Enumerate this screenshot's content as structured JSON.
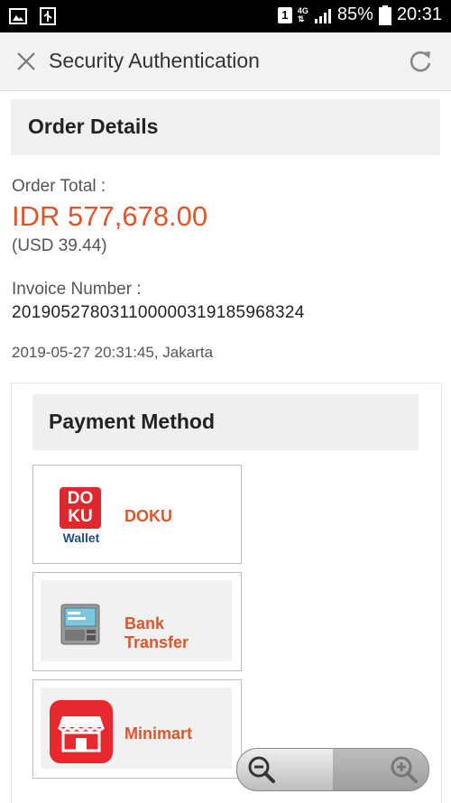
{
  "status_bar": {
    "sim_badge": "1",
    "network": "4G",
    "battery": "85%",
    "time": "20:31",
    "icons": [
      "image-icon",
      "usb-icon",
      "signal-icon",
      "battery-icon"
    ]
  },
  "header": {
    "title": "Security Authentication",
    "icons": [
      "close-icon",
      "refresh-icon"
    ]
  },
  "order": {
    "section_title": "Order Details",
    "total_label": "Order Total :",
    "total_value": "IDR 577,678.00",
    "total_usd": "(USD 39.44)",
    "invoice_label": "Invoice Number :",
    "invoice_number": "20190527803110000031918596832​4",
    "datetime": "2019-05-27 20:31:45, Jakarta"
  },
  "payment": {
    "section_title": "Payment Method",
    "options": [
      {
        "label": "DOKU",
        "logo_line1": "DO",
        "logo_line2": "KU",
        "logo_sub": "Wallet",
        "icon": "doku-wallet-icon"
      },
      {
        "label_line1": "Bank",
        "label_line2": "Transfer",
        "icon": "atm-icon"
      },
      {
        "label": "Minimart",
        "icon": "store-icon"
      }
    ]
  },
  "zoom_control": {
    "icons": [
      "zoom-out-icon",
      "zoom-in-icon"
    ]
  },
  "colors": {
    "accent": "#e0552a",
    "doku_red": "#e1262d",
    "doku_blue": "#1e4c8f",
    "minimart_red": "#e8282f"
  }
}
